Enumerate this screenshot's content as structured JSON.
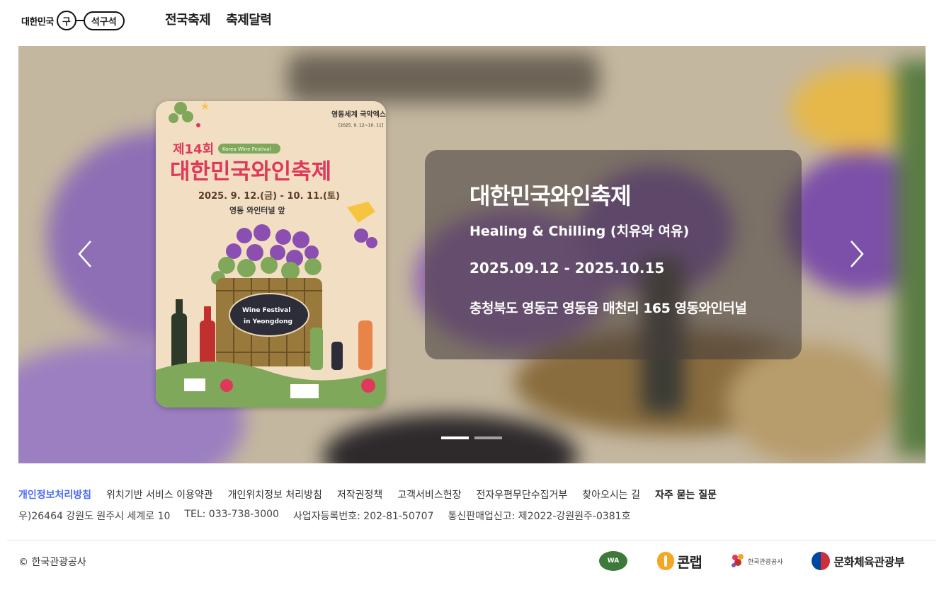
{
  "header": {
    "logo": {
      "part1": "대한민국",
      "part2": "구",
      "part3": "석구석"
    },
    "nav": [
      {
        "label": "전국축제"
      },
      {
        "label": "축제달력"
      }
    ]
  },
  "hero": {
    "festival_title": "대한민국와인축제",
    "subtitle": "Healing & Chilling (치유와 여유)",
    "date": "2025.09.12 - 2025.10.15",
    "address": "충청북도 영동군 영동읍 매천리 165 영동와인터널",
    "poster": {
      "top_event": "영동세계 국악엑스포",
      "top_event_date": "[2025. 9. 12~10. 11]",
      "edition": "제14회",
      "english_badge": "Korea Wine Festival",
      "title": "대한민국와인축제",
      "dates": "2025. 9. 12.(금) - 10. 11.(토)",
      "venue": "영동 와인터널 앞",
      "barrel_label_line1": "Wine Festival",
      "barrel_label_line2": "in Yeongdong"
    },
    "slides_total": 2,
    "active_slide": 1,
    "colors": {
      "overlay": "#463e3c",
      "poster_bg": "#f2dfc3",
      "poster_title": "#e0385a",
      "poster_green": "#4a8a2c"
    },
    "icons": {
      "prev": "chevron-left-icon",
      "next": "chevron-right-icon"
    }
  },
  "footer": {
    "links": [
      {
        "label": "개인정보처리방침"
      },
      {
        "label": "위치기반 서비스 이용약관"
      },
      {
        "label": "개인위치정보 처리방침"
      },
      {
        "label": "저작권정책"
      },
      {
        "label": "고객서비스헌장"
      },
      {
        "label": "전자우편무단수집거부"
      },
      {
        "label": "찾아오시는 길"
      },
      {
        "label": "자주 묻는 질문"
      }
    ],
    "info": [
      {
        "text": "우)26464 강원도 원주시 세계로 10"
      },
      {
        "text": "TEL: 033-738-3000"
      },
      {
        "text": "사업자등록번호: 202-81-50707"
      },
      {
        "text": "통신판매업신고: 제2022-강원원주-0381호"
      }
    ],
    "copyright": "© 한국관광공사",
    "partners": {
      "wa": "WA",
      "kcon": "콘랩",
      "kto": "한국관광공사",
      "mcst": "문화체육관광부"
    },
    "link_highlight_color": "#4a6cf7"
  }
}
